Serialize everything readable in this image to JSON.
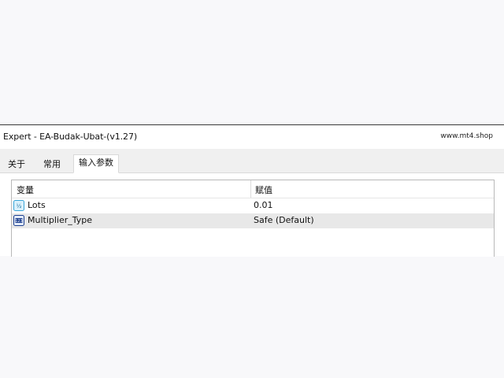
{
  "window": {
    "title": "Expert - EA-Budak-Ubat-(v1.27)",
    "watermark": "www.mt4.shop"
  },
  "tabs": [
    {
      "label": "关于",
      "active": false
    },
    {
      "label": "常用",
      "active": false
    },
    {
      "label": "输入参数",
      "active": true
    }
  ],
  "grid": {
    "headers": {
      "variable": "变量",
      "value": "赋值"
    },
    "rows": [
      {
        "name": "Lots",
        "value": "0.01",
        "icon": "number-variable-icon",
        "selected": false
      },
      {
        "name": "Multiplier_Type",
        "value": "Safe (Default)",
        "icon": "enum-variable-icon",
        "selected": true
      }
    ]
  },
  "colors": {
    "selected_row": "#e8e8e8",
    "icon_teal": "#3aa5d8",
    "icon_navy": "#1c3f8f"
  }
}
